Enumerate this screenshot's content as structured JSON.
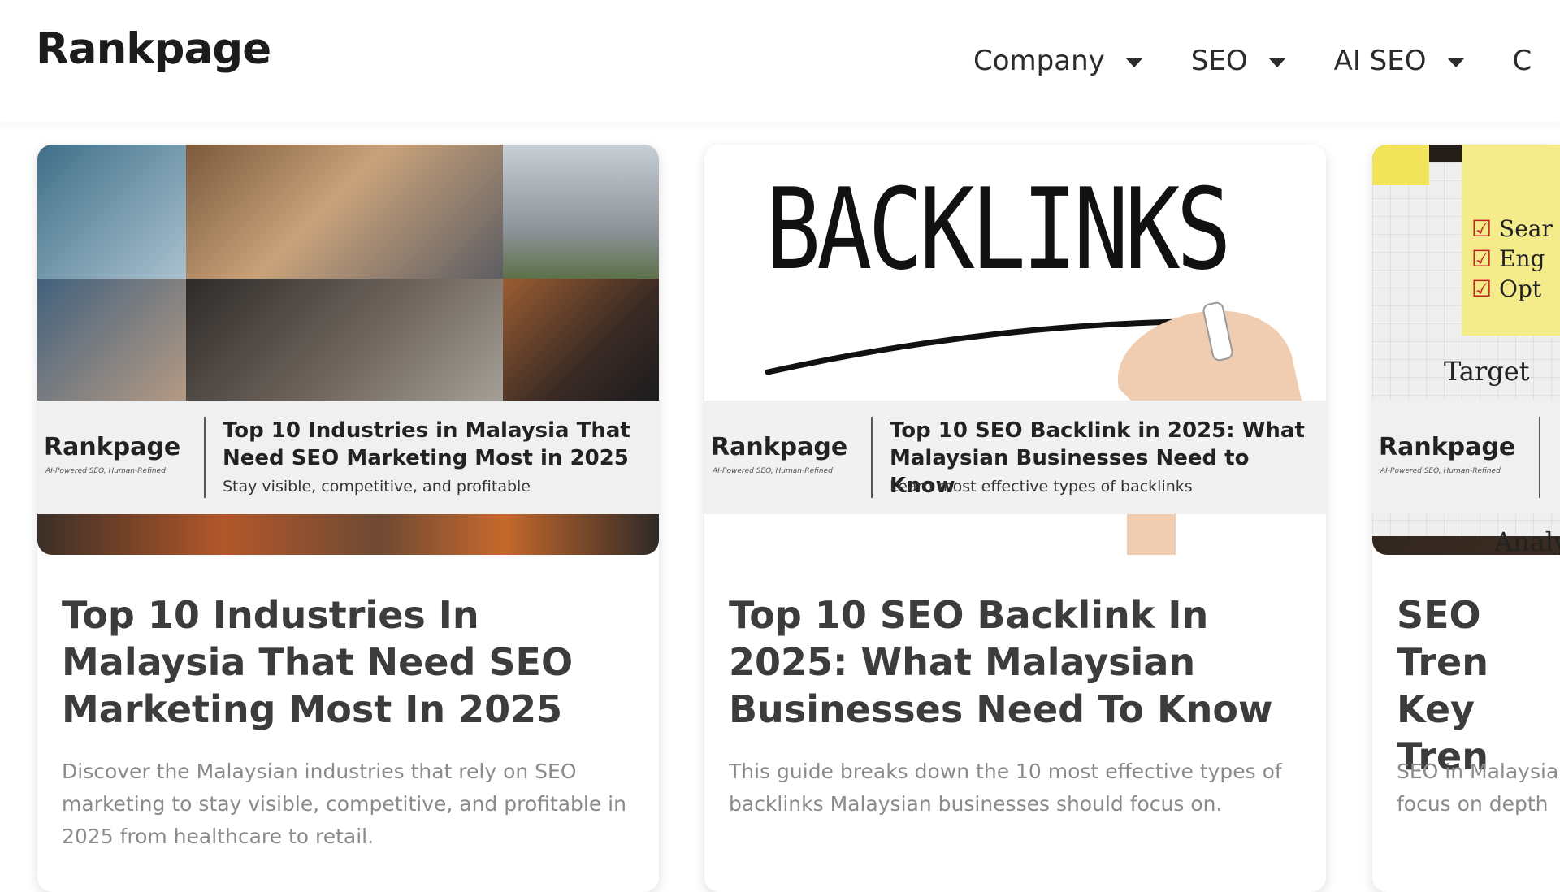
{
  "header": {
    "logo": "Rankpage",
    "nav": [
      {
        "label": "Company"
      },
      {
        "label": "SEO"
      },
      {
        "label": "AI SEO"
      },
      {
        "label": "C"
      }
    ]
  },
  "cards": [
    {
      "banner_brand": "Rankpage",
      "banner_tagline": "AI-Powered SEO, Human-Refined",
      "banner_title": "Top 10 Industries in Malaysia That Need SEO Marketing Most in 2025",
      "banner_subtitle": "Stay visible, competitive, and profitable",
      "title": "Top 10 Industries In Malaysia That Need SEO Marketing Most In 2025",
      "description": "Discover the Malaysian industries that rely on SEO marketing to stay visible, competitive, and profitable in 2025 from healthcare to retail."
    },
    {
      "image_text": "BACKLINKS",
      "banner_brand": "Rankpage",
      "banner_tagline": "AI-Powered SEO, Human-Refined",
      "banner_title": "Top 10 SEO Backlink in 2025: What Malaysian Businesses Need to Know",
      "banner_subtitle": "Learn most effective types of backlinks",
      "title": "Top 10 SEO Backlink In 2025: What Malaysian Businesses Need To Know",
      "description": "This guide breaks down the 10 most effective types of backlinks Malaysian businesses should focus on."
    },
    {
      "checklist": [
        "Sear",
        "Eng",
        "Opt"
      ],
      "image_text": "Target",
      "image_text_2": "Analy",
      "banner_brand": "Rankpage",
      "banner_tagline": "AI-Powered SEO, Human-Refined",
      "title": "SEO Tren Key Tren",
      "description": "SEO in Malaysia focus on depth"
    }
  ]
}
